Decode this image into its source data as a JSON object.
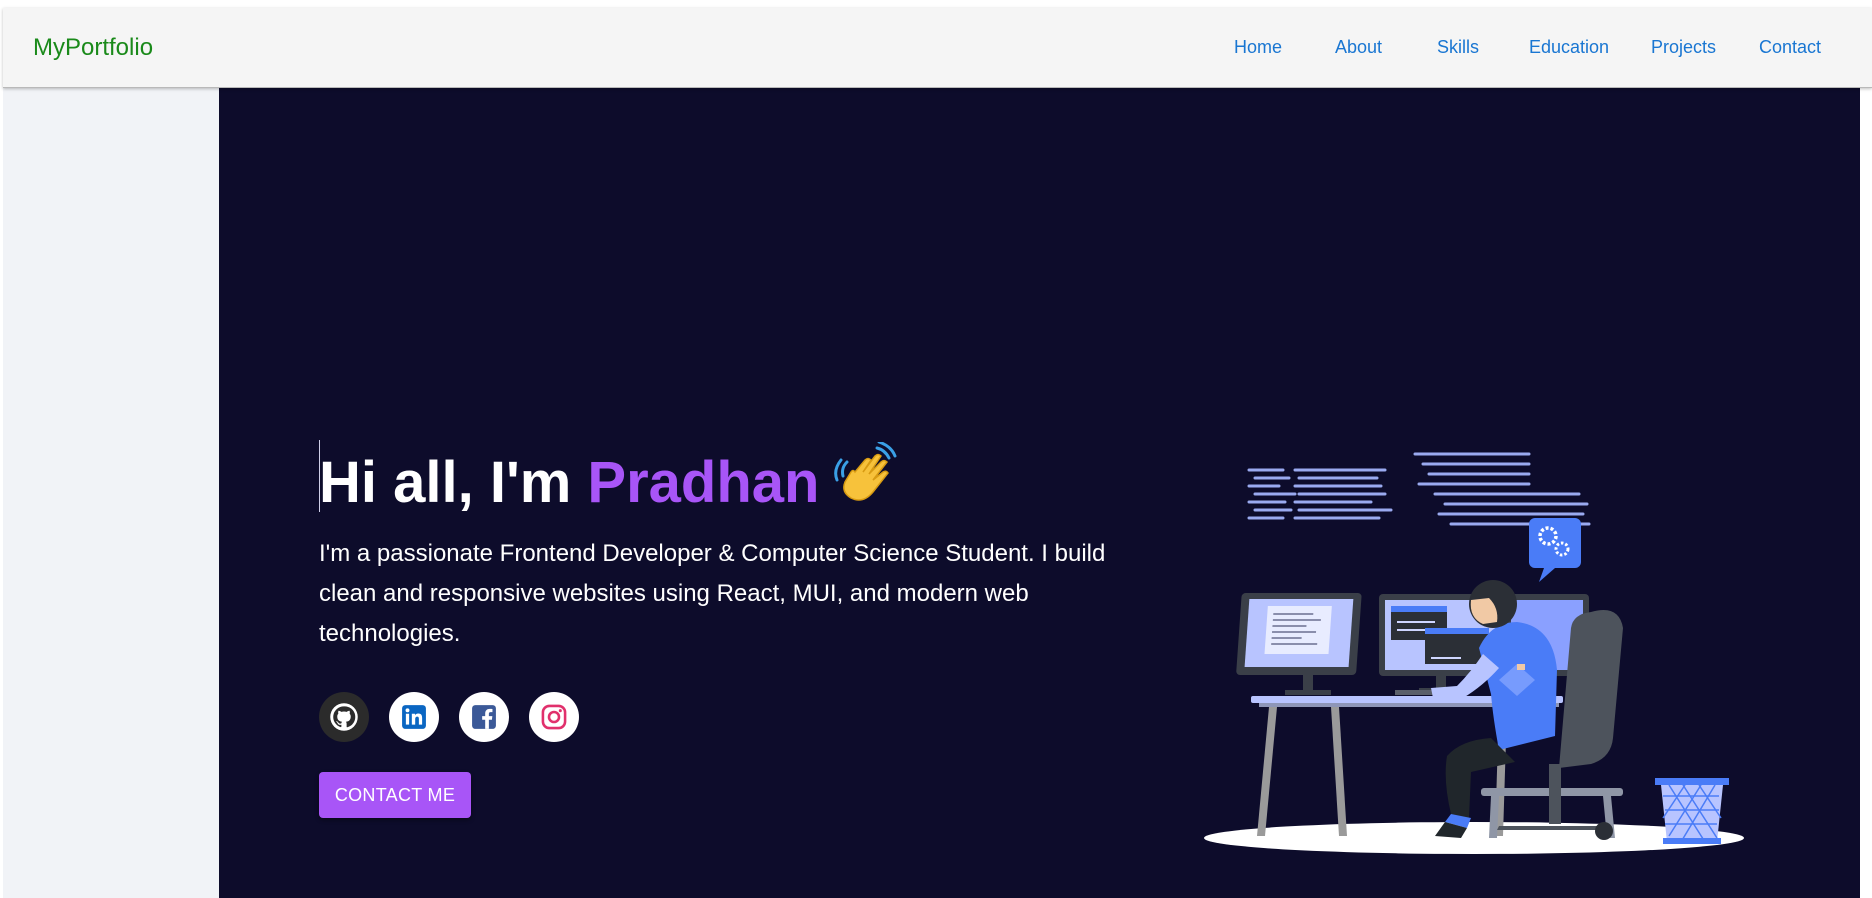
{
  "navbar": {
    "brand": "MyPortfolio",
    "links": [
      "Home",
      "About",
      "Skills",
      "Education",
      "Projects",
      "Contact"
    ]
  },
  "hero": {
    "greeting": "Hi all, I'm ",
    "name": "Pradhan",
    "bio": "I'm a passionate Frontend Developer & Computer Science Student. I build clean and responsive websites using React, MUI, and modern web technologies.",
    "cta_label": "CONTACT ME",
    "social_icons": [
      "github-icon",
      "linkedin-icon",
      "facebook-icon",
      "instagram-icon"
    ]
  },
  "colors": {
    "brand_green": "#1a8a1a",
    "nav_link_blue": "#1976d2",
    "hero_background": "#0d0c2b",
    "accent_purple": "#a855f7"
  }
}
